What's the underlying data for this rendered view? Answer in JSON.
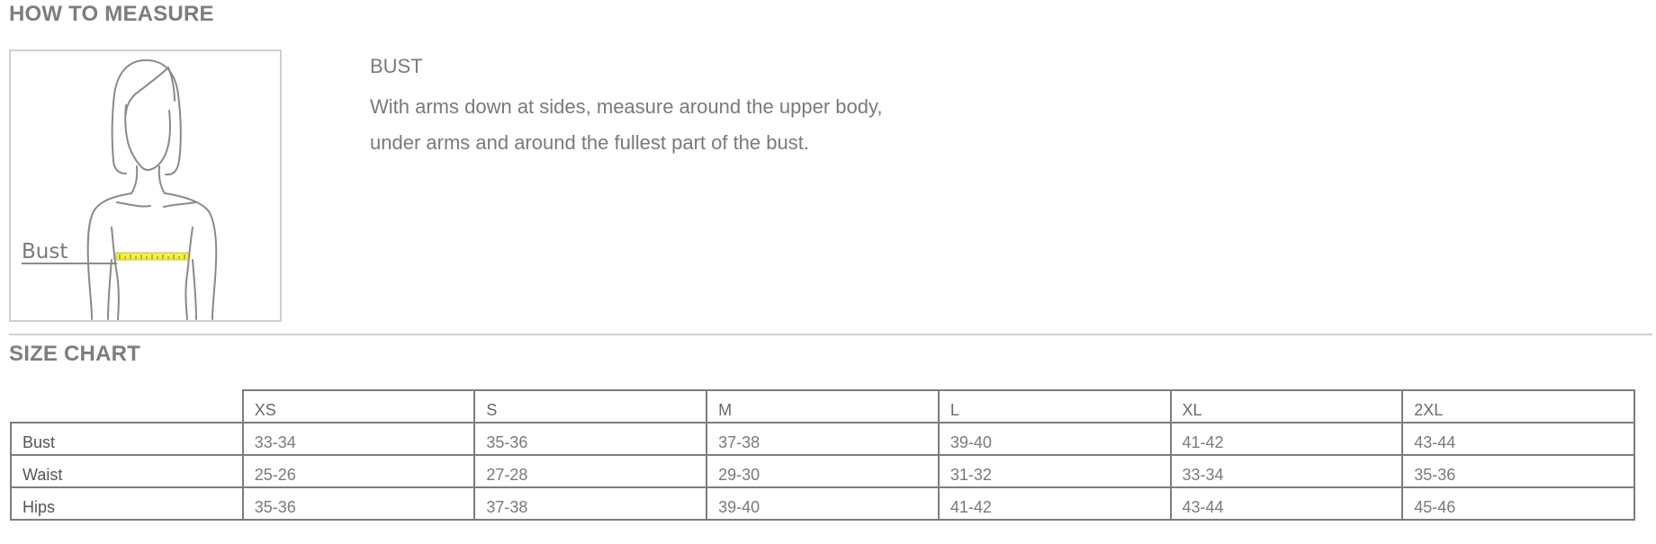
{
  "how_to_measure": {
    "heading": "HOW TO MEASURE",
    "figure_label": "Bust",
    "title": "BUST",
    "description_line1": "With arms down at sides, measure around the upper body,",
    "description_line2": "under arms and around the fullest part of the bust.",
    "tape_color": "#f2ef4a"
  },
  "size_chart": {
    "heading": "SIZE CHART",
    "columns": [
      "XS",
      "S",
      "M",
      "L",
      "XL",
      "2XL"
    ],
    "rows": [
      {
        "label": "Bust",
        "values": [
          "33-34",
          "35-36",
          "37-38",
          "39-40",
          "41-42",
          "43-44"
        ]
      },
      {
        "label": "Waist",
        "values": [
          "25-26",
          "27-28",
          "29-30",
          "31-32",
          "33-34",
          "35-36"
        ]
      },
      {
        "label": "Hips",
        "values": [
          "35-36",
          "37-38",
          "39-40",
          "41-42",
          "43-44",
          "45-46"
        ]
      }
    ]
  }
}
